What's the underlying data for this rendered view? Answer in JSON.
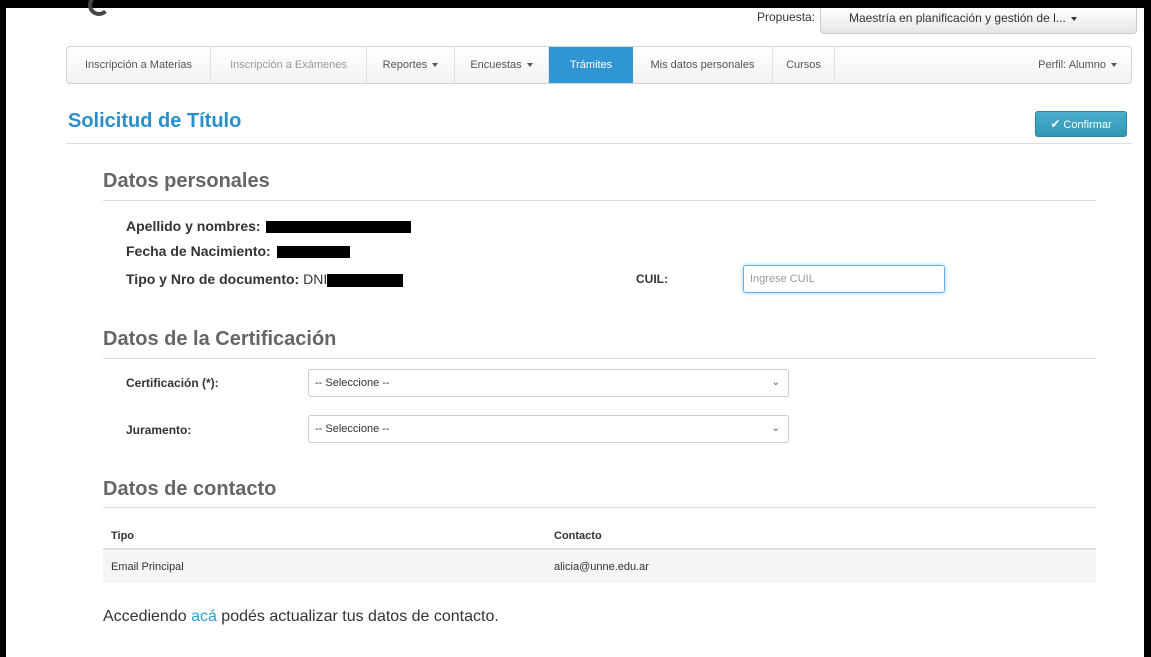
{
  "header": {
    "propuesta_label": "Propuesta:",
    "propuesta_value": "Maestría en planificación y gestión de l..."
  },
  "nav": {
    "items": [
      {
        "label": "Inscripción a Materias"
      },
      {
        "label": "Inscripción a Exámenes"
      },
      {
        "label": "Reportes"
      },
      {
        "label": "Encuestas"
      },
      {
        "label": "Trámites"
      },
      {
        "label": "Mis datos personales"
      },
      {
        "label": "Cursos"
      }
    ],
    "profile": "Perfil: Alumno"
  },
  "page": {
    "title": "Solicitud de Título",
    "confirm_label": "Confirmar"
  },
  "personal": {
    "heading": "Datos personales",
    "name_label": "Apellido y nombres:",
    "birth_label": "Fecha de Nacimiento:",
    "doc_label": "Tipo y Nro de documento:",
    "doc_prefix": "DNI",
    "cuil_label": "CUIL:",
    "cuil_placeholder": "Ingrese CUIL"
  },
  "certification": {
    "heading": "Datos de la Certificación",
    "cert_label": "Certificación (*):",
    "cert_value": "-- Seleccione --",
    "oath_label": "Juramento:",
    "oath_value": "-- Seleccione --"
  },
  "contact": {
    "heading": "Datos de contacto",
    "col_type": "Tipo",
    "col_contact": "Contacto",
    "rows": [
      {
        "type": "Email Principal",
        "contact": "alicia@unne.edu.ar"
      }
    ],
    "footer_before": "Accediendo ",
    "footer_link": "acá",
    "footer_after": " podés actualizar tus datos de contacto."
  },
  "colors": {
    "accent": "#2a8fc9",
    "active_tab": "#2f96d3",
    "confirm_button": "#49afcd"
  }
}
